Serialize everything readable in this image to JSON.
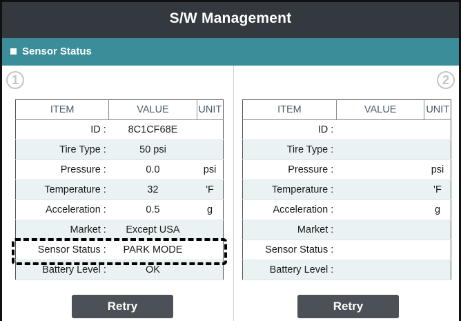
{
  "header": {
    "title": "S/W Management"
  },
  "section": {
    "label": "Sensor Status"
  },
  "table_headers": {
    "item": "ITEM",
    "value": "VALUE",
    "unit": "UNIT"
  },
  "sensors": [
    {
      "number": "1",
      "retry_label": "Retry",
      "rows": [
        {
          "item": "ID :",
          "value": "8C1CF68E",
          "unit": ""
        },
        {
          "item": "Tire Type :",
          "value": "50 psi",
          "unit": ""
        },
        {
          "item": "Pressure :",
          "value": "0.0",
          "unit": "psi"
        },
        {
          "item": "Temperature :",
          "value": "32",
          "unit": "'F"
        },
        {
          "item": "Acceleration :",
          "value": "0.5",
          "unit": "g"
        },
        {
          "item": "Market :",
          "value": "Except USA",
          "unit": ""
        },
        {
          "item": "Sensor Status :",
          "value": "PARK MODE",
          "unit": ""
        },
        {
          "item": "Battery Level :",
          "value": "OK",
          "unit": ""
        }
      ]
    },
    {
      "number": "2",
      "retry_label": "Retry",
      "rows": [
        {
          "item": "ID :",
          "value": "",
          "unit": ""
        },
        {
          "item": "Tire Type :",
          "value": "",
          "unit": ""
        },
        {
          "item": "Pressure :",
          "value": "",
          "unit": "psi"
        },
        {
          "item": "Temperature :",
          "value": "",
          "unit": "'F"
        },
        {
          "item": "Acceleration :",
          "value": "",
          "unit": "g"
        },
        {
          "item": "Market :",
          "value": "",
          "unit": ""
        },
        {
          "item": "Sensor Status :",
          "value": "",
          "unit": ""
        },
        {
          "item": "Battery Level :",
          "value": "",
          "unit": ""
        }
      ]
    }
  ]
}
